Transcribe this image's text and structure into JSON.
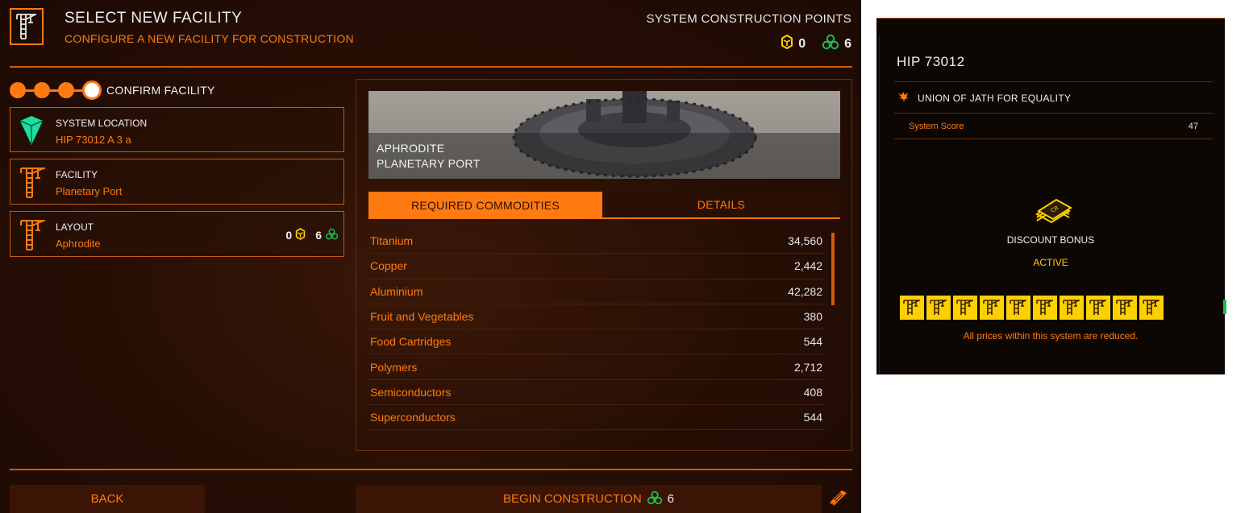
{
  "header": {
    "title": "SELECT NEW FACILITY",
    "subtitle": "CONFIGURE A NEW FACILITY FOR CONSTRUCTION",
    "points_title": "SYSTEM CONSTRUCTION POINTS",
    "tier2_points": "0",
    "tier3_points": "6"
  },
  "steps": {
    "count": 4,
    "active_label": "CONFIRM FACILITY"
  },
  "cards": {
    "location": {
      "label": "SYSTEM LOCATION",
      "value": "HIP 73012 A 3 a"
    },
    "facility": {
      "label": "FACILITY",
      "value": "Planetary Port"
    },
    "layout": {
      "label": "LAYOUT",
      "value": "Aphrodite",
      "tier2_cost": "0",
      "tier3_cost": "6"
    }
  },
  "facility_image": {
    "line1": "APHRODITE",
    "line2": "PLANETARY PORT"
  },
  "tabs": {
    "required": "REQUIRED COMMODITIES",
    "details": "DETAILS"
  },
  "commodities": [
    {
      "name": "Titanium",
      "qty": "34,560"
    },
    {
      "name": "Copper",
      "qty": "2,442"
    },
    {
      "name": "Aluminium",
      "qty": "42,282"
    },
    {
      "name": "Fruit and Vegetables",
      "qty": "380"
    },
    {
      "name": "Food Cartridges",
      "qty": "544"
    },
    {
      "name": "Polymers",
      "qty": "2,712"
    },
    {
      "name": "Semiconductors",
      "qty": "408"
    },
    {
      "name": "Superconductors",
      "qty": "544"
    }
  ],
  "footer": {
    "back": "BACK",
    "begin": "BEGIN CONSTRUCTION",
    "begin_cost": "6"
  },
  "side": {
    "system": "HIP 73012",
    "faction": "UNION OF JATH FOR EQUALITY",
    "score_label": "System Score",
    "score_value": "47",
    "discount_label": "DISCOUNT BONUS",
    "discount_status": "ACTIVE",
    "tier_count": 10,
    "discount_note": "All prices within this system are reduced."
  },
  "colors": {
    "accent": "#ff7a10",
    "tier2": "#ffd000",
    "tier3": "#18c050",
    "background": "#260e04"
  }
}
